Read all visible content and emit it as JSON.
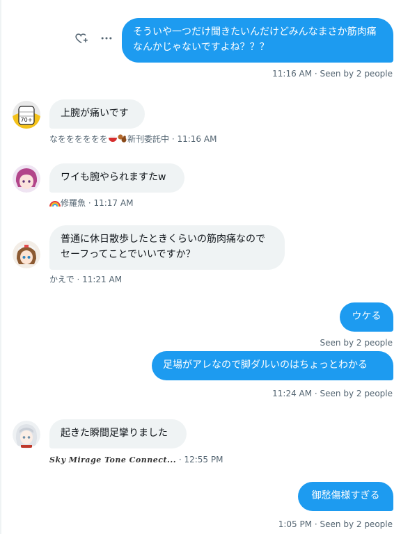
{
  "messages": [
    {
      "text": "そういや一つだけ聞きたいんだけどみんなまさか筋肉痛なんかじゃないですよね？？？",
      "meta": "11:16 AM · Seen by 2 people"
    },
    {
      "text": "上腕が痛いです",
      "sender": "なをををををを",
      "sender_suffix": "新刊委託中",
      "time": " · 11:16 AM"
    },
    {
      "text": "ワイも腕やられますたw",
      "sender": "修羅魚",
      "time": " · 11:17 AM"
    },
    {
      "text": "普通に休日散歩したときくらいの筋肉痛なのでセーフってことでいいですか？",
      "sender": "かえで",
      "time": " · 11:21 AM"
    },
    {
      "text": "ウケる",
      "meta": "Seen by 2 people"
    },
    {
      "text": "足場がアレなので脚ダルいのはちょっとわかる",
      "meta": "11:24 AM · Seen by 2 people"
    },
    {
      "text": "起きた瞬間足攣りました",
      "sender": "Sky Mirage Tone Connect...",
      "time": " · 12:55 PM"
    },
    {
      "text": "御愁傷様すぎる",
      "meta": "1:05 PM · Seen by 2 people"
    }
  ],
  "icons": [
    "heart-plus-icon",
    "more-icon",
    "bowl-emoji-icon",
    "squirrel-emoji-icon",
    "rainbow-emoji-icon"
  ],
  "colors": {
    "accent": "#1d9bf0",
    "incoming": "#eff3f4",
    "muted": "#536471"
  }
}
